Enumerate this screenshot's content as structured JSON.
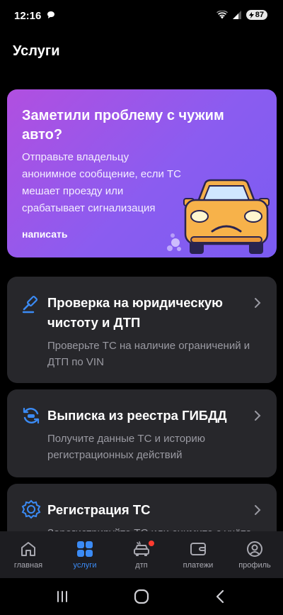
{
  "status": {
    "time": "12:16",
    "battery": "87"
  },
  "page": {
    "title": "Услуги"
  },
  "promo": {
    "title": "Заметили проблему с чужим авто?",
    "text": "Отправьте владельцу анонимное сообщение, если ТС мешает проезду или срабатывает сигнализация",
    "link": "написать"
  },
  "services": [
    {
      "icon": "gavel-icon",
      "title": "Проверка на юридическую чистоту и ДТП",
      "subtitle": "Проверьте ТС на наличие ограничений и ДТП по VIN"
    },
    {
      "icon": "registry-refresh-icon",
      "title": "Выписка из реестра ГИБДД",
      "subtitle": "Получите данные ТС и историю регистрационных действий"
    },
    {
      "icon": "registration-badge-icon",
      "title": "Регистрация ТС",
      "subtitle": "Зарегистрируйте ТС или снимите с учёта"
    }
  ],
  "nav": {
    "items": [
      {
        "label": "главная",
        "icon": "home-icon"
      },
      {
        "label": "услуги",
        "icon": "grid-icon",
        "active": true
      },
      {
        "label": "дтп",
        "icon": "car-accident-icon",
        "badge": true
      },
      {
        "label": "платежи",
        "icon": "wallet-icon"
      },
      {
        "label": "профиль",
        "icon": "profile-icon"
      }
    ]
  },
  "colors": {
    "accent": "#3b8bf5",
    "card": "#27272b",
    "promo_start": "#b14fe0",
    "promo_end": "#7a5bf2",
    "badge": "#ff3b30"
  }
}
